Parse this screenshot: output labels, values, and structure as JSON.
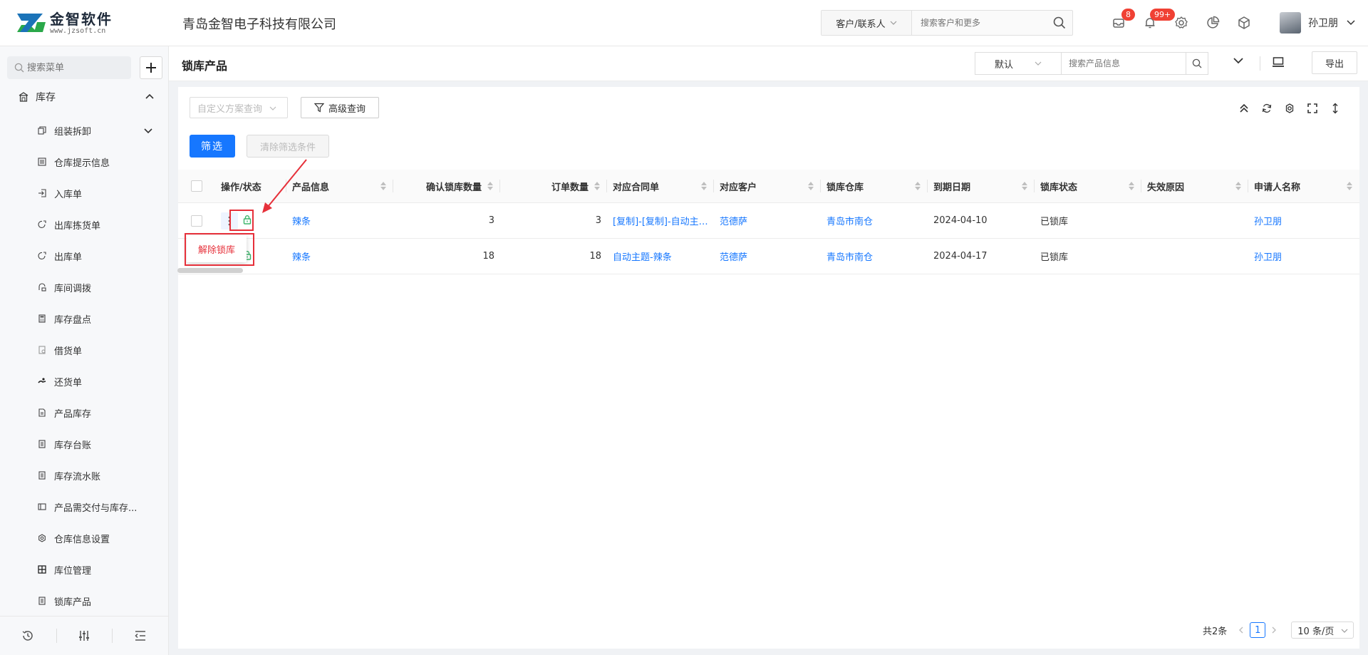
{
  "brand": {
    "logo_cn": "金智软件",
    "logo_url": "www.jzsoft.cn"
  },
  "company": "青岛金智电子科技有限公司",
  "global_search": {
    "type": "客户/联系人",
    "placeholder": "搜索客户和更多"
  },
  "notifications": {
    "messages_badge": "8",
    "alerts_badge": "99+"
  },
  "user": {
    "name": "孙卫朋"
  },
  "sidebar": {
    "search_placeholder": "搜索菜单",
    "section": "库存",
    "items": [
      {
        "label": "组装拆卸",
        "icon": "assemble-icon"
      },
      {
        "label": "仓库提示信息",
        "icon": "list-icon"
      },
      {
        "label": "入库单",
        "icon": "inbound-icon"
      },
      {
        "label": "出库拣货单",
        "icon": "pick-icon"
      },
      {
        "label": "出库单",
        "icon": "outbound-icon"
      },
      {
        "label": "库间调拨",
        "icon": "transfer-icon"
      },
      {
        "label": "库存盘点",
        "icon": "calculator-icon"
      },
      {
        "label": "借货单",
        "icon": "borrow-icon"
      },
      {
        "label": "还货单",
        "icon": "return-icon"
      },
      {
        "label": "产品库存",
        "icon": "doc-icon"
      },
      {
        "label": "库存台账",
        "icon": "ledger-icon"
      },
      {
        "label": "库存流水账",
        "icon": "flow-icon"
      },
      {
        "label": "产品需交付与库存...",
        "icon": "book-icon"
      },
      {
        "label": "仓库信息设置",
        "icon": "gear-icon"
      },
      {
        "label": "库位管理",
        "icon": "grid-icon"
      },
      {
        "label": "锁库产品",
        "icon": "lock-doc-icon"
      }
    ]
  },
  "page": {
    "title": "锁库产品",
    "view": "默认",
    "search_placeholder": "搜索产品信息",
    "export_label": "导出",
    "scheme_placeholder": "自定义方案查询",
    "advanced_label": "高级查询",
    "filter_label": "筛选",
    "clear_label": "清除筛选条件"
  },
  "table": {
    "columns": [
      "操作/状态",
      "产品信息",
      "确认锁库数量",
      "订单数量",
      "对应合同单",
      "对应客户",
      "锁库仓库",
      "到期日期",
      "锁库状态",
      "失效原因",
      "申请人名称"
    ],
    "rows": [
      {
        "product": "辣条",
        "locked_qty": "3",
        "order_qty": "3",
        "contract": "[复制]-[复制]-自动主题-辣条",
        "customer": "范德萨",
        "warehouse": "青岛市南仓",
        "due": "2024-04-10",
        "status": "已锁库",
        "reason": "",
        "applicant": "孙卫朋"
      },
      {
        "product": "辣条",
        "locked_qty": "18",
        "order_qty": "18",
        "contract": "自动主题-辣条",
        "customer": "范德萨",
        "warehouse": "青岛市南仓",
        "due": "2024-04-17",
        "status": "已锁库",
        "reason": "",
        "applicant": "孙卫朋"
      }
    ]
  },
  "row_menu": {
    "unlock_label": "解除锁库"
  },
  "pagination": {
    "total": "共2条",
    "current": "1",
    "page_size": "10 条/页"
  },
  "colors": {
    "primary": "#1677ff",
    "danger": "#e6303a",
    "lock_green": "#3bb56a"
  }
}
